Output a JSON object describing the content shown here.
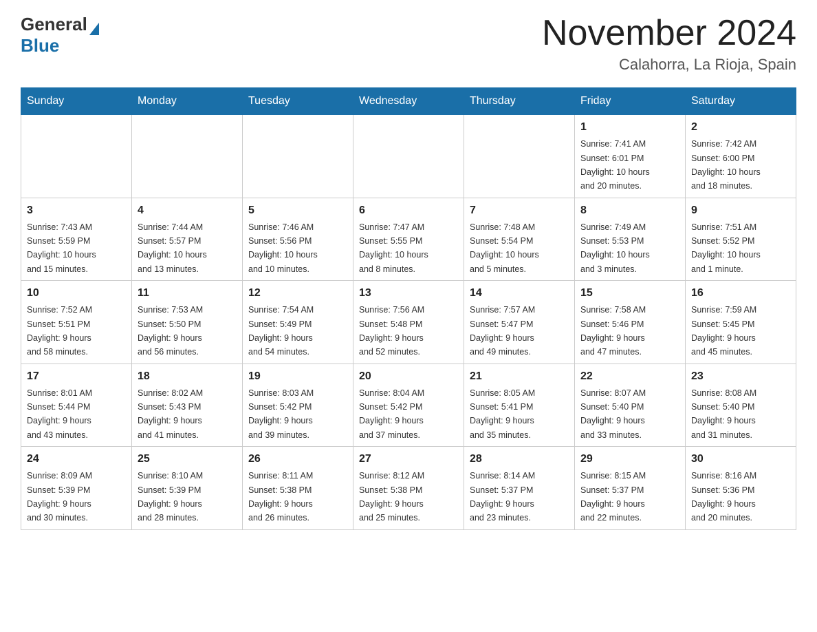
{
  "header": {
    "logo_general": "General",
    "logo_blue": "Blue",
    "month_title": "November 2024",
    "location": "Calahorra, La Rioja, Spain"
  },
  "days_of_week": [
    "Sunday",
    "Monday",
    "Tuesday",
    "Wednesday",
    "Thursday",
    "Friday",
    "Saturday"
  ],
  "weeks": [
    [
      {
        "day": "",
        "info": ""
      },
      {
        "day": "",
        "info": ""
      },
      {
        "day": "",
        "info": ""
      },
      {
        "day": "",
        "info": ""
      },
      {
        "day": "",
        "info": ""
      },
      {
        "day": "1",
        "info": "Sunrise: 7:41 AM\nSunset: 6:01 PM\nDaylight: 10 hours\nand 20 minutes."
      },
      {
        "day": "2",
        "info": "Sunrise: 7:42 AM\nSunset: 6:00 PM\nDaylight: 10 hours\nand 18 minutes."
      }
    ],
    [
      {
        "day": "3",
        "info": "Sunrise: 7:43 AM\nSunset: 5:59 PM\nDaylight: 10 hours\nand 15 minutes."
      },
      {
        "day": "4",
        "info": "Sunrise: 7:44 AM\nSunset: 5:57 PM\nDaylight: 10 hours\nand 13 minutes."
      },
      {
        "day": "5",
        "info": "Sunrise: 7:46 AM\nSunset: 5:56 PM\nDaylight: 10 hours\nand 10 minutes."
      },
      {
        "day": "6",
        "info": "Sunrise: 7:47 AM\nSunset: 5:55 PM\nDaylight: 10 hours\nand 8 minutes."
      },
      {
        "day": "7",
        "info": "Sunrise: 7:48 AM\nSunset: 5:54 PM\nDaylight: 10 hours\nand 5 minutes."
      },
      {
        "day": "8",
        "info": "Sunrise: 7:49 AM\nSunset: 5:53 PM\nDaylight: 10 hours\nand 3 minutes."
      },
      {
        "day": "9",
        "info": "Sunrise: 7:51 AM\nSunset: 5:52 PM\nDaylight: 10 hours\nand 1 minute."
      }
    ],
    [
      {
        "day": "10",
        "info": "Sunrise: 7:52 AM\nSunset: 5:51 PM\nDaylight: 9 hours\nand 58 minutes."
      },
      {
        "day": "11",
        "info": "Sunrise: 7:53 AM\nSunset: 5:50 PM\nDaylight: 9 hours\nand 56 minutes."
      },
      {
        "day": "12",
        "info": "Sunrise: 7:54 AM\nSunset: 5:49 PM\nDaylight: 9 hours\nand 54 minutes."
      },
      {
        "day": "13",
        "info": "Sunrise: 7:56 AM\nSunset: 5:48 PM\nDaylight: 9 hours\nand 52 minutes."
      },
      {
        "day": "14",
        "info": "Sunrise: 7:57 AM\nSunset: 5:47 PM\nDaylight: 9 hours\nand 49 minutes."
      },
      {
        "day": "15",
        "info": "Sunrise: 7:58 AM\nSunset: 5:46 PM\nDaylight: 9 hours\nand 47 minutes."
      },
      {
        "day": "16",
        "info": "Sunrise: 7:59 AM\nSunset: 5:45 PM\nDaylight: 9 hours\nand 45 minutes."
      }
    ],
    [
      {
        "day": "17",
        "info": "Sunrise: 8:01 AM\nSunset: 5:44 PM\nDaylight: 9 hours\nand 43 minutes."
      },
      {
        "day": "18",
        "info": "Sunrise: 8:02 AM\nSunset: 5:43 PM\nDaylight: 9 hours\nand 41 minutes."
      },
      {
        "day": "19",
        "info": "Sunrise: 8:03 AM\nSunset: 5:42 PM\nDaylight: 9 hours\nand 39 minutes."
      },
      {
        "day": "20",
        "info": "Sunrise: 8:04 AM\nSunset: 5:42 PM\nDaylight: 9 hours\nand 37 minutes."
      },
      {
        "day": "21",
        "info": "Sunrise: 8:05 AM\nSunset: 5:41 PM\nDaylight: 9 hours\nand 35 minutes."
      },
      {
        "day": "22",
        "info": "Sunrise: 8:07 AM\nSunset: 5:40 PM\nDaylight: 9 hours\nand 33 minutes."
      },
      {
        "day": "23",
        "info": "Sunrise: 8:08 AM\nSunset: 5:40 PM\nDaylight: 9 hours\nand 31 minutes."
      }
    ],
    [
      {
        "day": "24",
        "info": "Sunrise: 8:09 AM\nSunset: 5:39 PM\nDaylight: 9 hours\nand 30 minutes."
      },
      {
        "day": "25",
        "info": "Sunrise: 8:10 AM\nSunset: 5:39 PM\nDaylight: 9 hours\nand 28 minutes."
      },
      {
        "day": "26",
        "info": "Sunrise: 8:11 AM\nSunset: 5:38 PM\nDaylight: 9 hours\nand 26 minutes."
      },
      {
        "day": "27",
        "info": "Sunrise: 8:12 AM\nSunset: 5:38 PM\nDaylight: 9 hours\nand 25 minutes."
      },
      {
        "day": "28",
        "info": "Sunrise: 8:14 AM\nSunset: 5:37 PM\nDaylight: 9 hours\nand 23 minutes."
      },
      {
        "day": "29",
        "info": "Sunrise: 8:15 AM\nSunset: 5:37 PM\nDaylight: 9 hours\nand 22 minutes."
      },
      {
        "day": "30",
        "info": "Sunrise: 8:16 AM\nSunset: 5:36 PM\nDaylight: 9 hours\nand 20 minutes."
      }
    ]
  ]
}
